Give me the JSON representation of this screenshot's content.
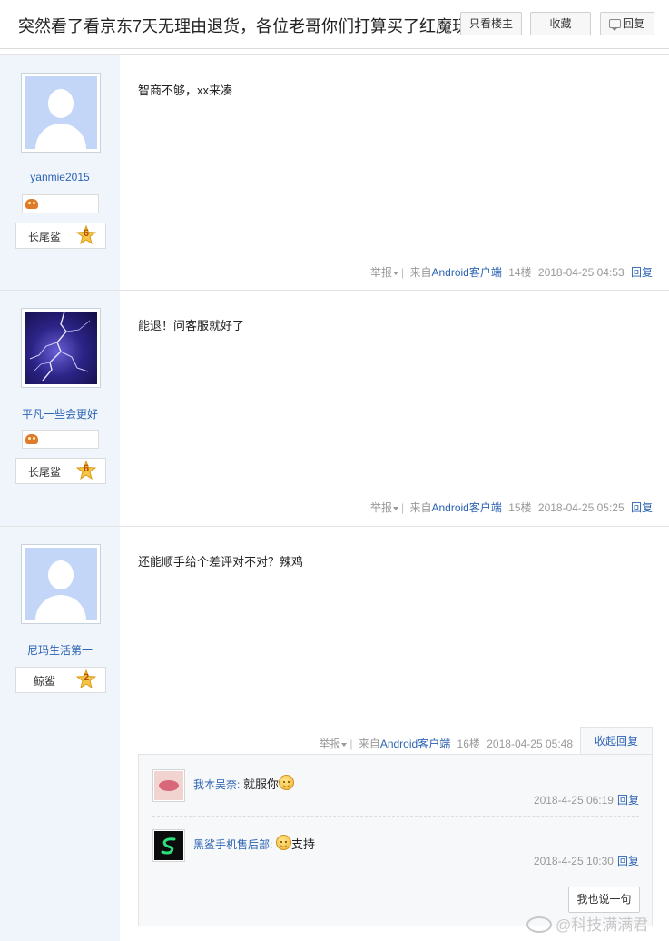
{
  "header": {
    "title": "突然看了看京东7天无理由退货，各位老哥你们打算买了红魔玩...",
    "only_op_label": "只看楼主",
    "favorite_label": "收藏",
    "reply_label": "回复"
  },
  "posts": [
    {
      "username": "yanmie2015",
      "avatar": "default-avatar",
      "level_name": "长尾鲨",
      "level_num": "6",
      "content": "智商不够，xx来凑",
      "meta": {
        "report": "举报",
        "from_prefix": "来自",
        "client": "Android客户端",
        "floor": "14楼",
        "time": "2018-04-25 04:53",
        "reply": "回复"
      }
    },
    {
      "username": "平凡一些会更好",
      "avatar": "lightning-avatar",
      "level_name": "长尾鲨",
      "level_num": "6",
      "content": "能退！问客服就好了",
      "meta": {
        "report": "举报",
        "from_prefix": "来自",
        "client": "Android客户端",
        "floor": "15楼",
        "time": "2018-04-25 05:25",
        "reply": "回复"
      }
    },
    {
      "username": "尼玛生活第一",
      "avatar": "default-avatar",
      "level_name": "鲸鲨",
      "level_num": "2",
      "content": "还能顺手给个差评对不对？辣鸡",
      "meta": {
        "report": "举报",
        "from_prefix": "来自",
        "client": "Android客户端",
        "floor": "16楼",
        "time": "2018-04-25 05:48",
        "collapse": "收起回复"
      },
      "sub_replies": [
        {
          "name": "我本吴奈:",
          "text_before": " 就服你",
          "text_after": "",
          "time": "2018-4-25 06:19",
          "reply": "回复",
          "avatar": "lips-avatar"
        },
        {
          "name": "黑鲨手机售后部:",
          "text_before": " ",
          "text_after": "支持",
          "time": "2018-4-25 10:30",
          "reply": "回复",
          "avatar": "shark-avatar"
        }
      ],
      "say_button": "我也说一句"
    }
  ],
  "watermark": "@科技满满君",
  "colors": {
    "link": "#2d64b3",
    "sidebar": "#f0f5fb",
    "meta": "#999999"
  }
}
